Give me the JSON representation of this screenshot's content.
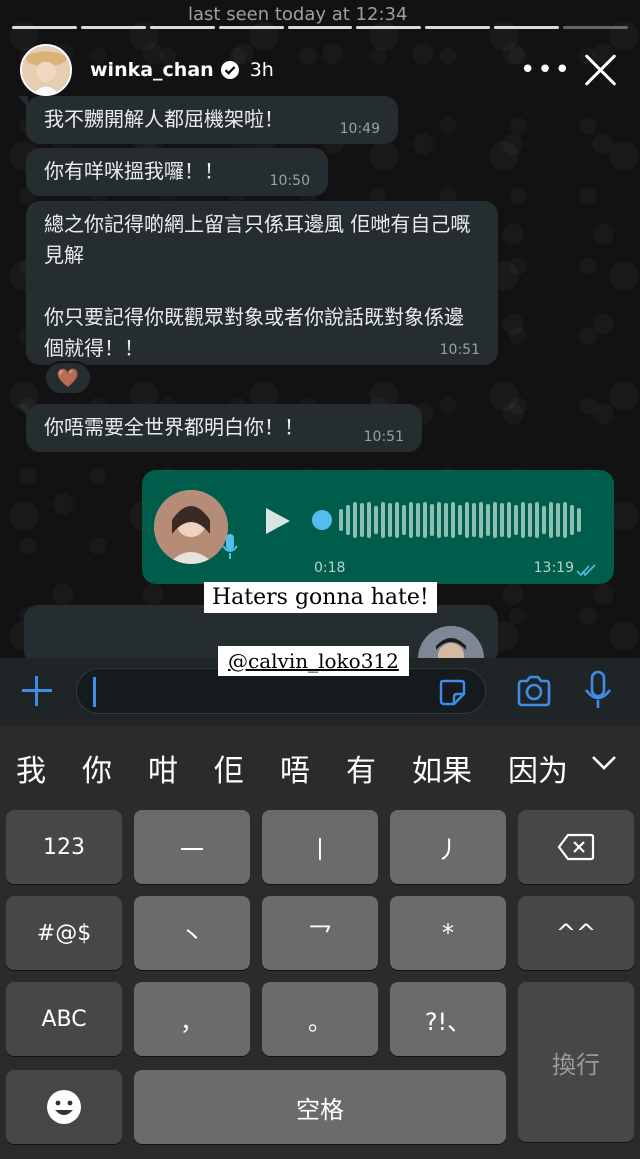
{
  "chat_header": {
    "status": "last seen today at 12:34"
  },
  "story": {
    "username": "winka_chan",
    "time_ago": "3h",
    "more_label": "•••"
  },
  "messages": [
    {
      "id": "b1",
      "text": "我不嬲開解人都屈機架啦！",
      "time": "10:49"
    },
    {
      "id": "b2",
      "text": "你有咩咪搵我囉！！",
      "time": "10:50"
    },
    {
      "id": "b3",
      "lines": [
        "總之你記得啲網上留言只係耳邊風 佢哋有自己嘅見解",
        "你只要記得你既觀眾對象或者你說話既對象係邊個就得！！"
      ],
      "time": "10:51"
    },
    {
      "id": "b4",
      "text": "你唔需要全世界都明白你！！",
      "time": "10:51"
    }
  ],
  "reaction": {
    "emoji": "🤎"
  },
  "voice_message": {
    "duration": "0:18",
    "time": "13:19",
    "status": "read",
    "progress": 0.0
  },
  "story_overlays": {
    "caption": "Haters gonna hate!",
    "mention": "@calvin_loko312"
  },
  "input_bar": {
    "value": ""
  },
  "keyboard": {
    "candidates": [
      "我",
      "你",
      "咁",
      "佢",
      "唔",
      "有",
      "如果",
      "因为"
    ],
    "row1": [
      "123",
      "一",
      "丨",
      "丿"
    ],
    "row2": [
      "#@$",
      "丶",
      "乛",
      "*",
      "^^"
    ],
    "row3": [
      "ABC",
      "，",
      "。",
      "?!、"
    ],
    "return_label": "換行",
    "space_label": "空格"
  },
  "icons": {
    "verified": "verified-badge-icon",
    "close": "close-icon",
    "plus": "plus-icon",
    "sticker": "sticker-icon",
    "camera": "camera-icon",
    "mic": "microphone-icon",
    "backspace": "backspace-icon",
    "emoji": "emoji-icon",
    "play": "play-icon"
  },
  "colors": {
    "outgoing_bubble": "#005c4b",
    "incoming_bubble": "#262d31",
    "accent_blue": "#53bdeb",
    "icon_blue": "#3e8ee8"
  }
}
